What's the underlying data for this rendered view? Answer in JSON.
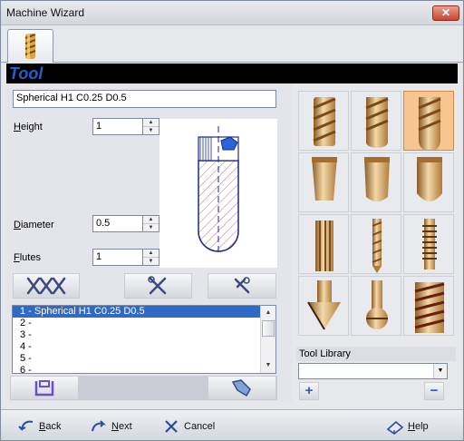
{
  "window": {
    "title": "Machine Wizard",
    "close_glyph": "✕"
  },
  "section": {
    "title": "Tool"
  },
  "tool": {
    "name": "Spherical H1 C0.25 D0.5",
    "height_label_first": "H",
    "height_label_rest": "eight",
    "height_value": "1",
    "diameter_label_first": "D",
    "diameter_label_rest": "iameter",
    "diameter_value": "0.5",
    "flutes_label_first": "F",
    "flutes_label_rest": "lutes",
    "flutes_value": "1"
  },
  "tool_list": [
    "1 - Spherical H1 C0.25 D0.5",
    "2 -",
    "3 -",
    "4 -",
    "5 -",
    "6 -"
  ],
  "library": {
    "label": "Tool Library",
    "selected": "",
    "add_glyph": "+",
    "remove_glyph": "−"
  },
  "footer": {
    "back_first": "B",
    "back_rest": "ack",
    "next_first": "N",
    "next_rest": "ext",
    "cancel": "Cancel",
    "help_first": "H",
    "help_rest": "elp"
  },
  "icons": {
    "tab": "drill-bit-icon",
    "save": "save-disk-icon",
    "open": "open-folder-icon",
    "multi_tools": "multiple-tools-icon",
    "edit_tool": "edit-tool-icon",
    "tool_settings": "tool-settings-icon"
  },
  "colors": {
    "accent": "#2a5cc9",
    "selection": "#3169c6",
    "selected_cell": "#f7c590"
  }
}
